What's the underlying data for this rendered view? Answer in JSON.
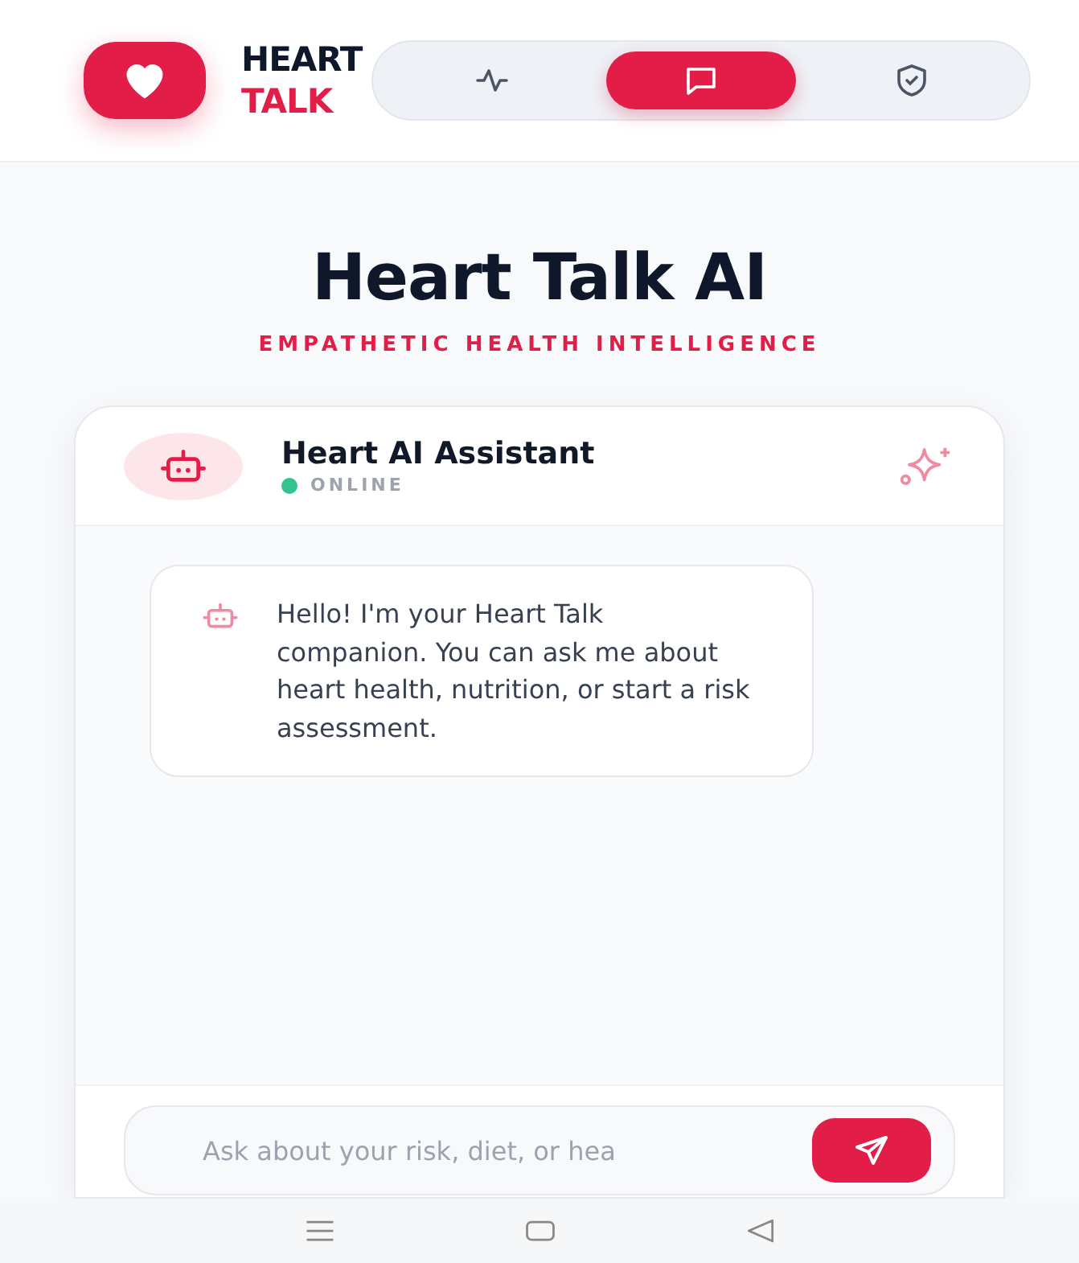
{
  "brand": {
    "line_1": "HEART",
    "line_2": "TALK"
  },
  "tabs": [
    {
      "kind": "pulse",
      "selected": false
    },
    {
      "kind": "chat",
      "selected": true
    },
    {
      "kind": "shield",
      "selected": false
    }
  ],
  "hero": {
    "title": "Heart Talk AI",
    "subtitle": "EMPATHETIC HEALTH INTELLIGENCE"
  },
  "chat": {
    "name": "Heart AI Assistant",
    "status": "ONLINE",
    "online": true,
    "messages": [
      {
        "text": "Hello! I'm your Heart Talk companion. You can ask me about heart health, nutrition, or start a risk assessment."
      }
    ],
    "input": {
      "placeholder": "Ask about your risk, diet, or hea"
    }
  }
}
